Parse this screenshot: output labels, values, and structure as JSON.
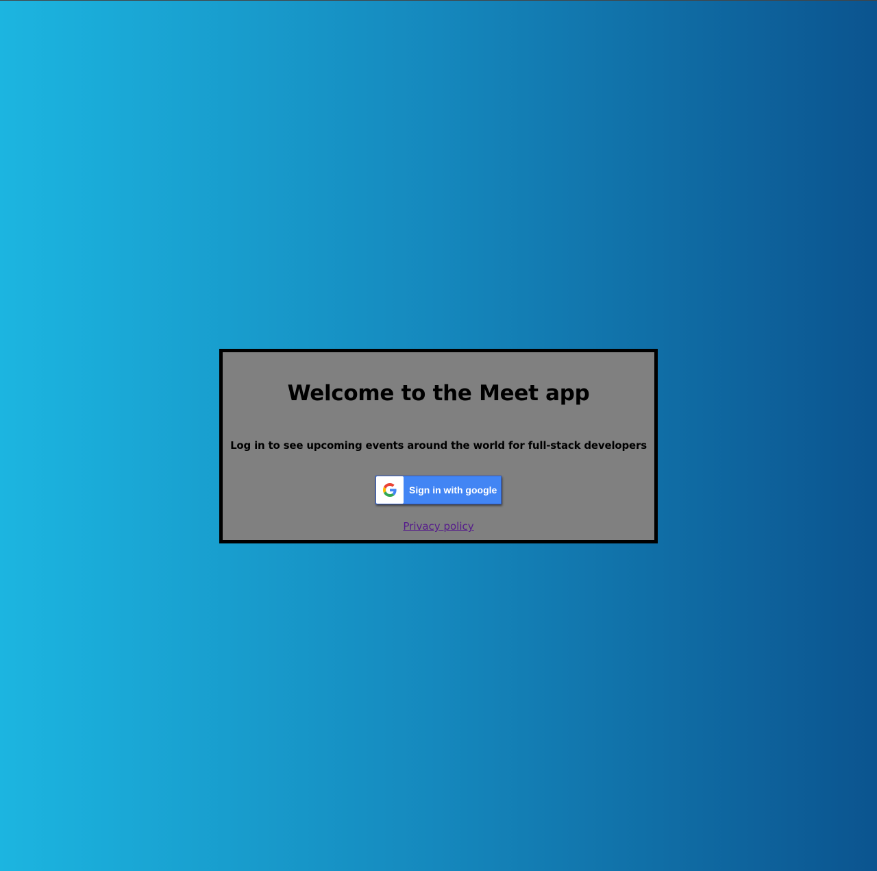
{
  "login": {
    "title": "Welcome to the Meet app",
    "subtitle": "Log in to see upcoming events around the world for full-stack developers",
    "google_button": {
      "label": "Sign in with google",
      "icon": "google-g-icon"
    },
    "privacy_link": "Privacy policy"
  },
  "colors": {
    "gradient_start": "#1cb5e0",
    "gradient_end": "#0b548f",
    "card_background": "#808080",
    "card_border": "#000000",
    "google_blue": "#4285f4",
    "link_visited": "#551a8b"
  }
}
